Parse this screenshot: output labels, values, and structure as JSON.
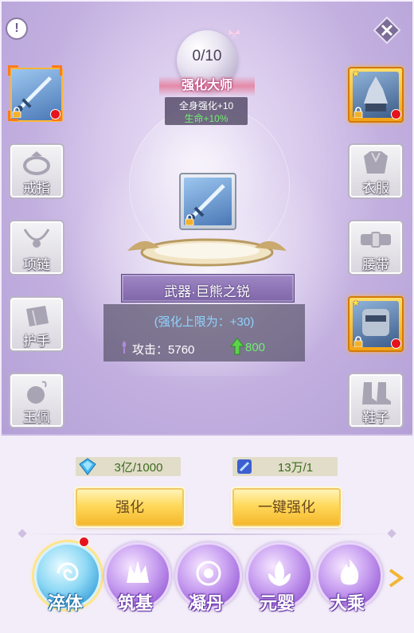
{
  "master": {
    "progress": "0/10",
    "title": "强化大师",
    "bonus_line": "全身强化+10",
    "effect_line": "生命+10%"
  },
  "left_slots": [
    {
      "label": "戒指",
      "icon": "ring-icon"
    },
    {
      "label": "项链",
      "icon": "necklace-icon"
    },
    {
      "label": "护手",
      "icon": "bracer-icon"
    },
    {
      "label": "玉佩",
      "icon": "jade-pendant-icon"
    }
  ],
  "right_slots": [
    {
      "label": "衣服",
      "icon": "armor-icon"
    },
    {
      "label": "腰带",
      "icon": "belt-icon"
    },
    {
      "label": "鞋子",
      "icon": "boots-icon"
    }
  ],
  "item": {
    "name": "武器·巨熊之锐",
    "limit_text": "(强化上限为：+30)",
    "attack_label": "攻击：",
    "attack_value": "5760",
    "attack_gain": "800"
  },
  "resources": {
    "gem_cost": "3亿/1000",
    "stone_cost": "13万/1"
  },
  "buttons": {
    "enhance": "强化",
    "one_click": "一键强化"
  },
  "tabs": [
    {
      "label": "淬体",
      "active": true
    },
    {
      "label": "筑基",
      "active": false
    },
    {
      "label": "凝丹",
      "active": false
    },
    {
      "label": "元婴",
      "active": false
    },
    {
      "label": "大乘",
      "active": false
    }
  ],
  "colors": {
    "accent_gold": "#ffd95b",
    "status_green": "#6ef06e",
    "limit_blue": "#8fd3ff",
    "alert_red": "#e5141c"
  }
}
